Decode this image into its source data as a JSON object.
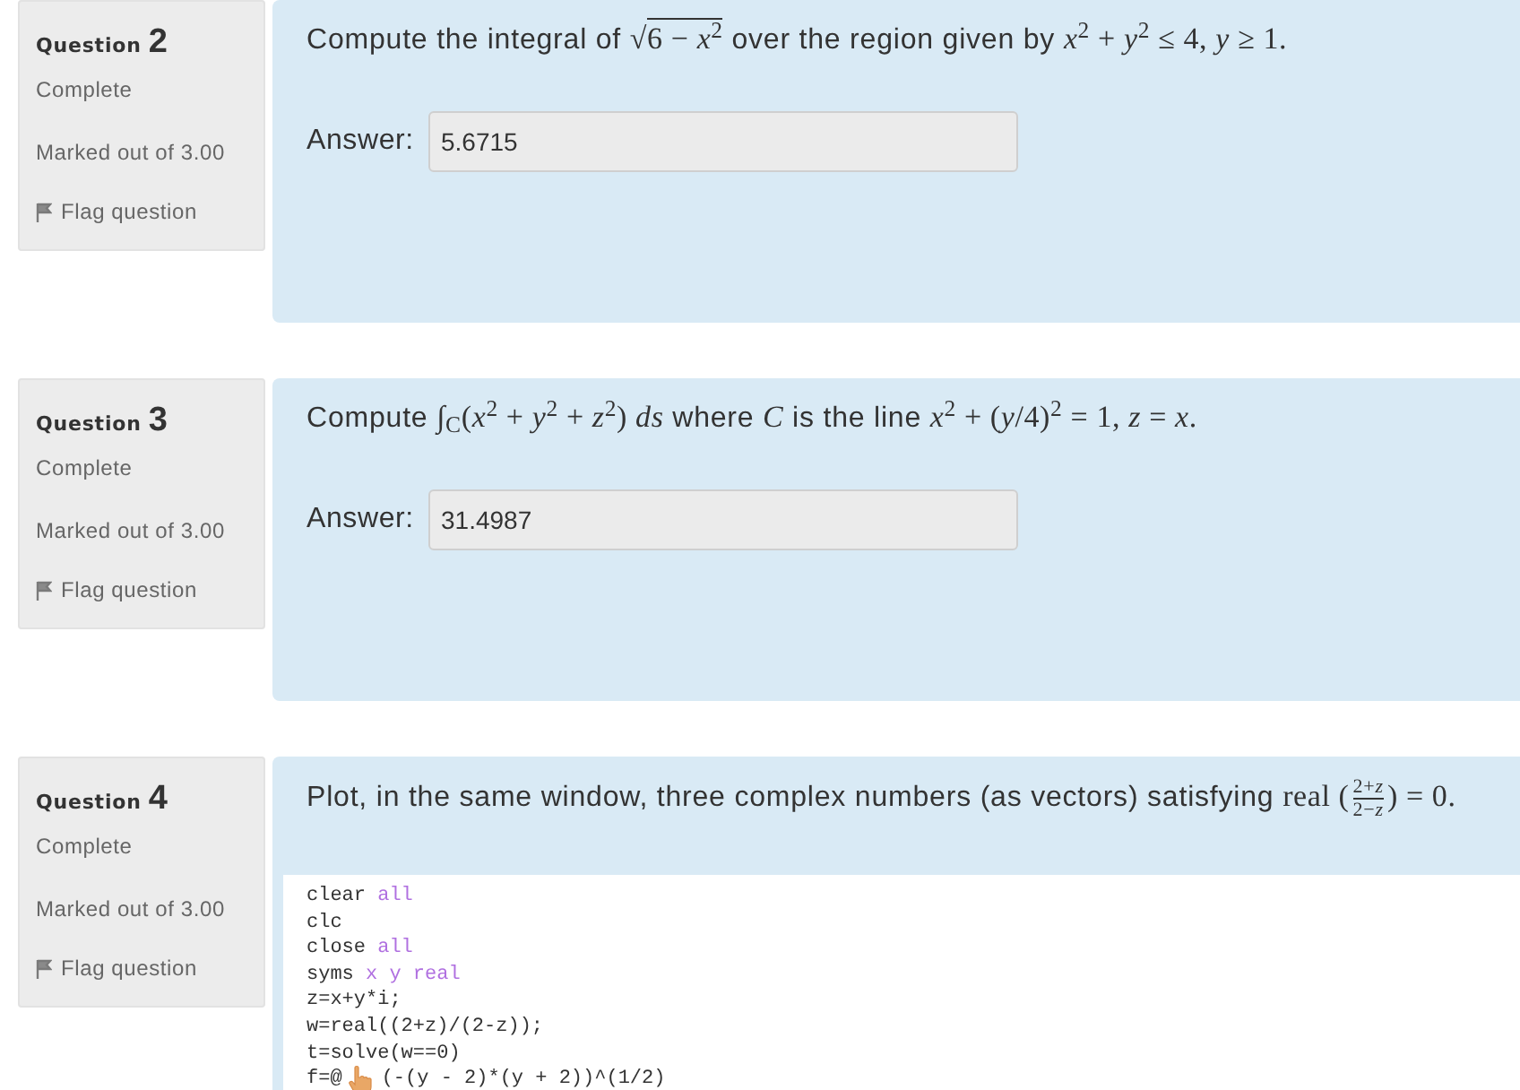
{
  "questions": [
    {
      "label": "Question",
      "number": "2",
      "status": "Complete",
      "marks": "Marked out of 3.00",
      "flag_link": "Flag question",
      "text": [
        {
          "kind": "text",
          "text": "Compute the integral of "
        },
        {
          "kind": "sqrt",
          "sign": "√",
          "radicand": "6 − *x*$^{2}$"
        },
        {
          "kind": "text",
          "text": " over the region given by "
        },
        {
          "kind": "math",
          "text": "*x*$^{2}$ + *y*$^{2}$ ≤ 4, *y* ≥ 1."
        }
      ],
      "answer": {
        "label": "Answer:",
        "value": "5.6715"
      }
    },
    {
      "label": "Question",
      "number": "3",
      "status": "Complete",
      "marks": "Marked out of 3.00",
      "flag_link": "Flag question",
      "text": [
        {
          "kind": "text",
          "text": "Compute "
        },
        {
          "kind": "math",
          "text": "∫$_{C}$(*x*$^{2}$ + *y*$^{2}$ + *z*$^{2}$) *ds*"
        },
        {
          "kind": "text",
          "text": " where "
        },
        {
          "kind": "math",
          "text": "*C*"
        },
        {
          "kind": "text",
          "text": " is the line "
        },
        {
          "kind": "math",
          "text": "*x*$^{2}$ + (*y*/4)$^{2}$ = 1, *z* = *x*."
        }
      ],
      "answer": {
        "label": "Answer:",
        "value": "31.4987"
      }
    },
    {
      "label": "Question",
      "number": "4",
      "status": "Complete",
      "marks": "Marked out of 3.00",
      "flag_link": "Flag question",
      "text": [
        {
          "kind": "text",
          "text": "Plot, in the same window, three complex numbers (as vectors) satisfying "
        },
        {
          "kind": "math",
          "text": "real ("
        },
        {
          "kind": "frac",
          "numerator": "2+*z*",
          "denominator": "2−*z*"
        },
        {
          "kind": "math",
          "text": ") = 0."
        }
      ],
      "code": [
        {
          "tokens": [
            {
              "kind": "plain",
              "text": "clear "
            },
            {
              "kind": "keyword",
              "text": "all"
            }
          ]
        },
        {
          "tokens": [
            {
              "kind": "plain",
              "text": "clc"
            }
          ]
        },
        {
          "tokens": [
            {
              "kind": "plain",
              "text": "close "
            },
            {
              "kind": "keyword",
              "text": "all"
            }
          ]
        },
        {
          "tokens": [
            {
              "kind": "plain",
              "text": "syms "
            },
            {
              "kind": "keyword",
              "text": "x y real"
            }
          ]
        },
        {
          "tokens": [
            {
              "kind": "plain",
              "text": "z=x+y*i;"
            }
          ]
        },
        {
          "tokens": [
            {
              "kind": "plain",
              "text": "w=real((2+z)/(2-z));"
            }
          ]
        },
        {
          "tokens": [
            {
              "kind": "plain",
              "text": "t=solve(w==0)"
            }
          ]
        },
        {
          "tokens": [
            {
              "kind": "plain",
              "text": "f=@"
            },
            {
              "kind": "cursor"
            },
            {
              "kind": "plain",
              "text": "(-(y - 2)*(y + 2))^(1/2)"
            }
          ]
        }
      ]
    }
  ]
}
